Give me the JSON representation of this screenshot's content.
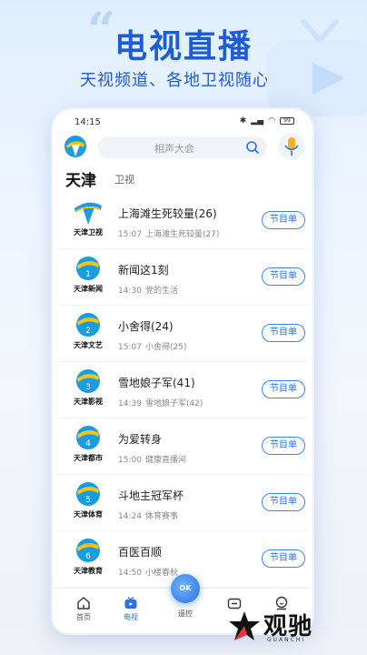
{
  "promo": {
    "quote_mark": "“",
    "title": "电视直播",
    "subtitle": "天视频道、各地卫视随心看"
  },
  "status_bar": {
    "time": "14:15",
    "battery": "99"
  },
  "search": {
    "placeholder": "相声大会"
  },
  "region": {
    "title": "天津",
    "tab": "卫视"
  },
  "schedule_label": "节目单",
  "channels": [
    {
      "logo_name": "天津卫视",
      "logo_number": "",
      "program": "上海滩生死较量(26)",
      "next_time": "15:07",
      "next_program": "上海滩生死较量(27)"
    },
    {
      "logo_name": "天津新闻",
      "logo_number": "1",
      "program": "新闻这1刻",
      "next_time": "14:30",
      "next_program": "党的生活"
    },
    {
      "logo_name": "天津文艺",
      "logo_number": "2",
      "program": "小舍得(24)",
      "next_time": "15:07",
      "next_program": "小舍得(25)"
    },
    {
      "logo_name": "天津影视",
      "logo_number": "3",
      "program": "雪地娘子军(41)",
      "next_time": "14:39",
      "next_program": "雪地娘子军(42)"
    },
    {
      "logo_name": "天津都市",
      "logo_number": "4",
      "program": "为爱转身",
      "next_time": "15:00",
      "next_program": "健康直播间"
    },
    {
      "logo_name": "天津体育",
      "logo_number": "5",
      "program": "斗地主冠军杯",
      "next_time": "14:24",
      "next_program": "体育赛事"
    },
    {
      "logo_name": "天津教育",
      "logo_number": "6",
      "program": "百医百顺",
      "next_time": "14:50",
      "next_program": "小楼春秋"
    }
  ],
  "bottom_nav": {
    "home": "首页",
    "tv": "电视",
    "remote": "遥控",
    "remote_fab": "OK",
    "screen": "",
    "profile": ""
  },
  "brand": {
    "name": "观驰",
    "sub": "GUANCHI"
  },
  "colors": {
    "accent": "#2a72df",
    "title_blue": "#1e5cd6"
  }
}
